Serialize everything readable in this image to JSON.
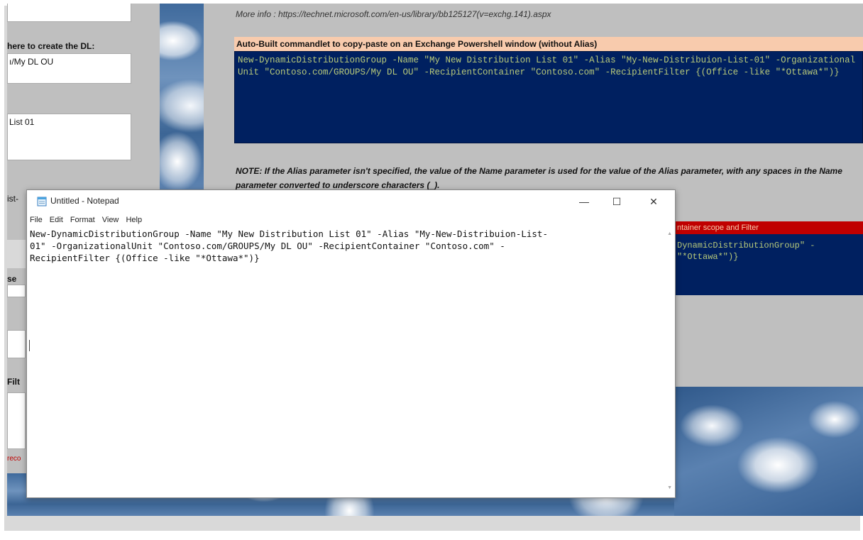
{
  "left_panel": {
    "dl_location_label": "here to create the DL:",
    "dl_location_value": "ı/My DL OU",
    "name_value": "List 01",
    "alias_fragment": "ist-",
    "recipient_fragment": "se",
    "filter_fragment": "Filt",
    "red_fragment": "reco"
  },
  "sheet": {
    "more_info": "More info : https://technet.microsoft.com/en-us/library/bb125127(v=exchg.141).aspx",
    "cmd_header": "Auto-Built commandlet to copy-paste on an Exchange Powershell window (without Alias)",
    "cmd_text": "New-DynamicDistributionGroup -Name \"My New Distribution List 01\" -Alias \"My-New-Distribuion-List-01\" -OrganizationalUnit \"Contoso.com/GROUPS/My DL OU\" -RecipientContainer \"Contoso.com\" -RecipientFilter {(Office -like \"*Ottawa*\")}",
    "note": "NOTE: If the Alias parameter isn't specified, the value of the Name parameter is used for the value of the Alias parameter, with any spaces in the Name parameter converted to underscore characters (_).",
    "cmd_header2": "ntainer scope and Filter",
    "cmd_text2": "DynamicDistributionGroup\" -\n\"*Ottawa*\")}"
  },
  "notepad": {
    "title": "Untitled - Notepad",
    "minimize_glyph": "—",
    "maximize_glyph": "☐",
    "close_glyph": "✕",
    "menu": [
      "File",
      "Edit",
      "Format",
      "View",
      "Help"
    ],
    "content": "New-DynamicDistributionGroup -Name \"My New Distribution List 01\" -Alias \"My-New-Distribuion-List-\n01\" -OrganizationalUnit \"Contoso.com/GROUPS/My DL OU\" -RecipientContainer \"Contoso.com\" -\nRecipientFilter {(Office -like \"*Ottawa*\")}"
  },
  "colors": {
    "cmd_bg": "#002060",
    "cmd_text": "#b7c97a",
    "header_peach": "#f8cbad",
    "header_red": "#c00000"
  }
}
